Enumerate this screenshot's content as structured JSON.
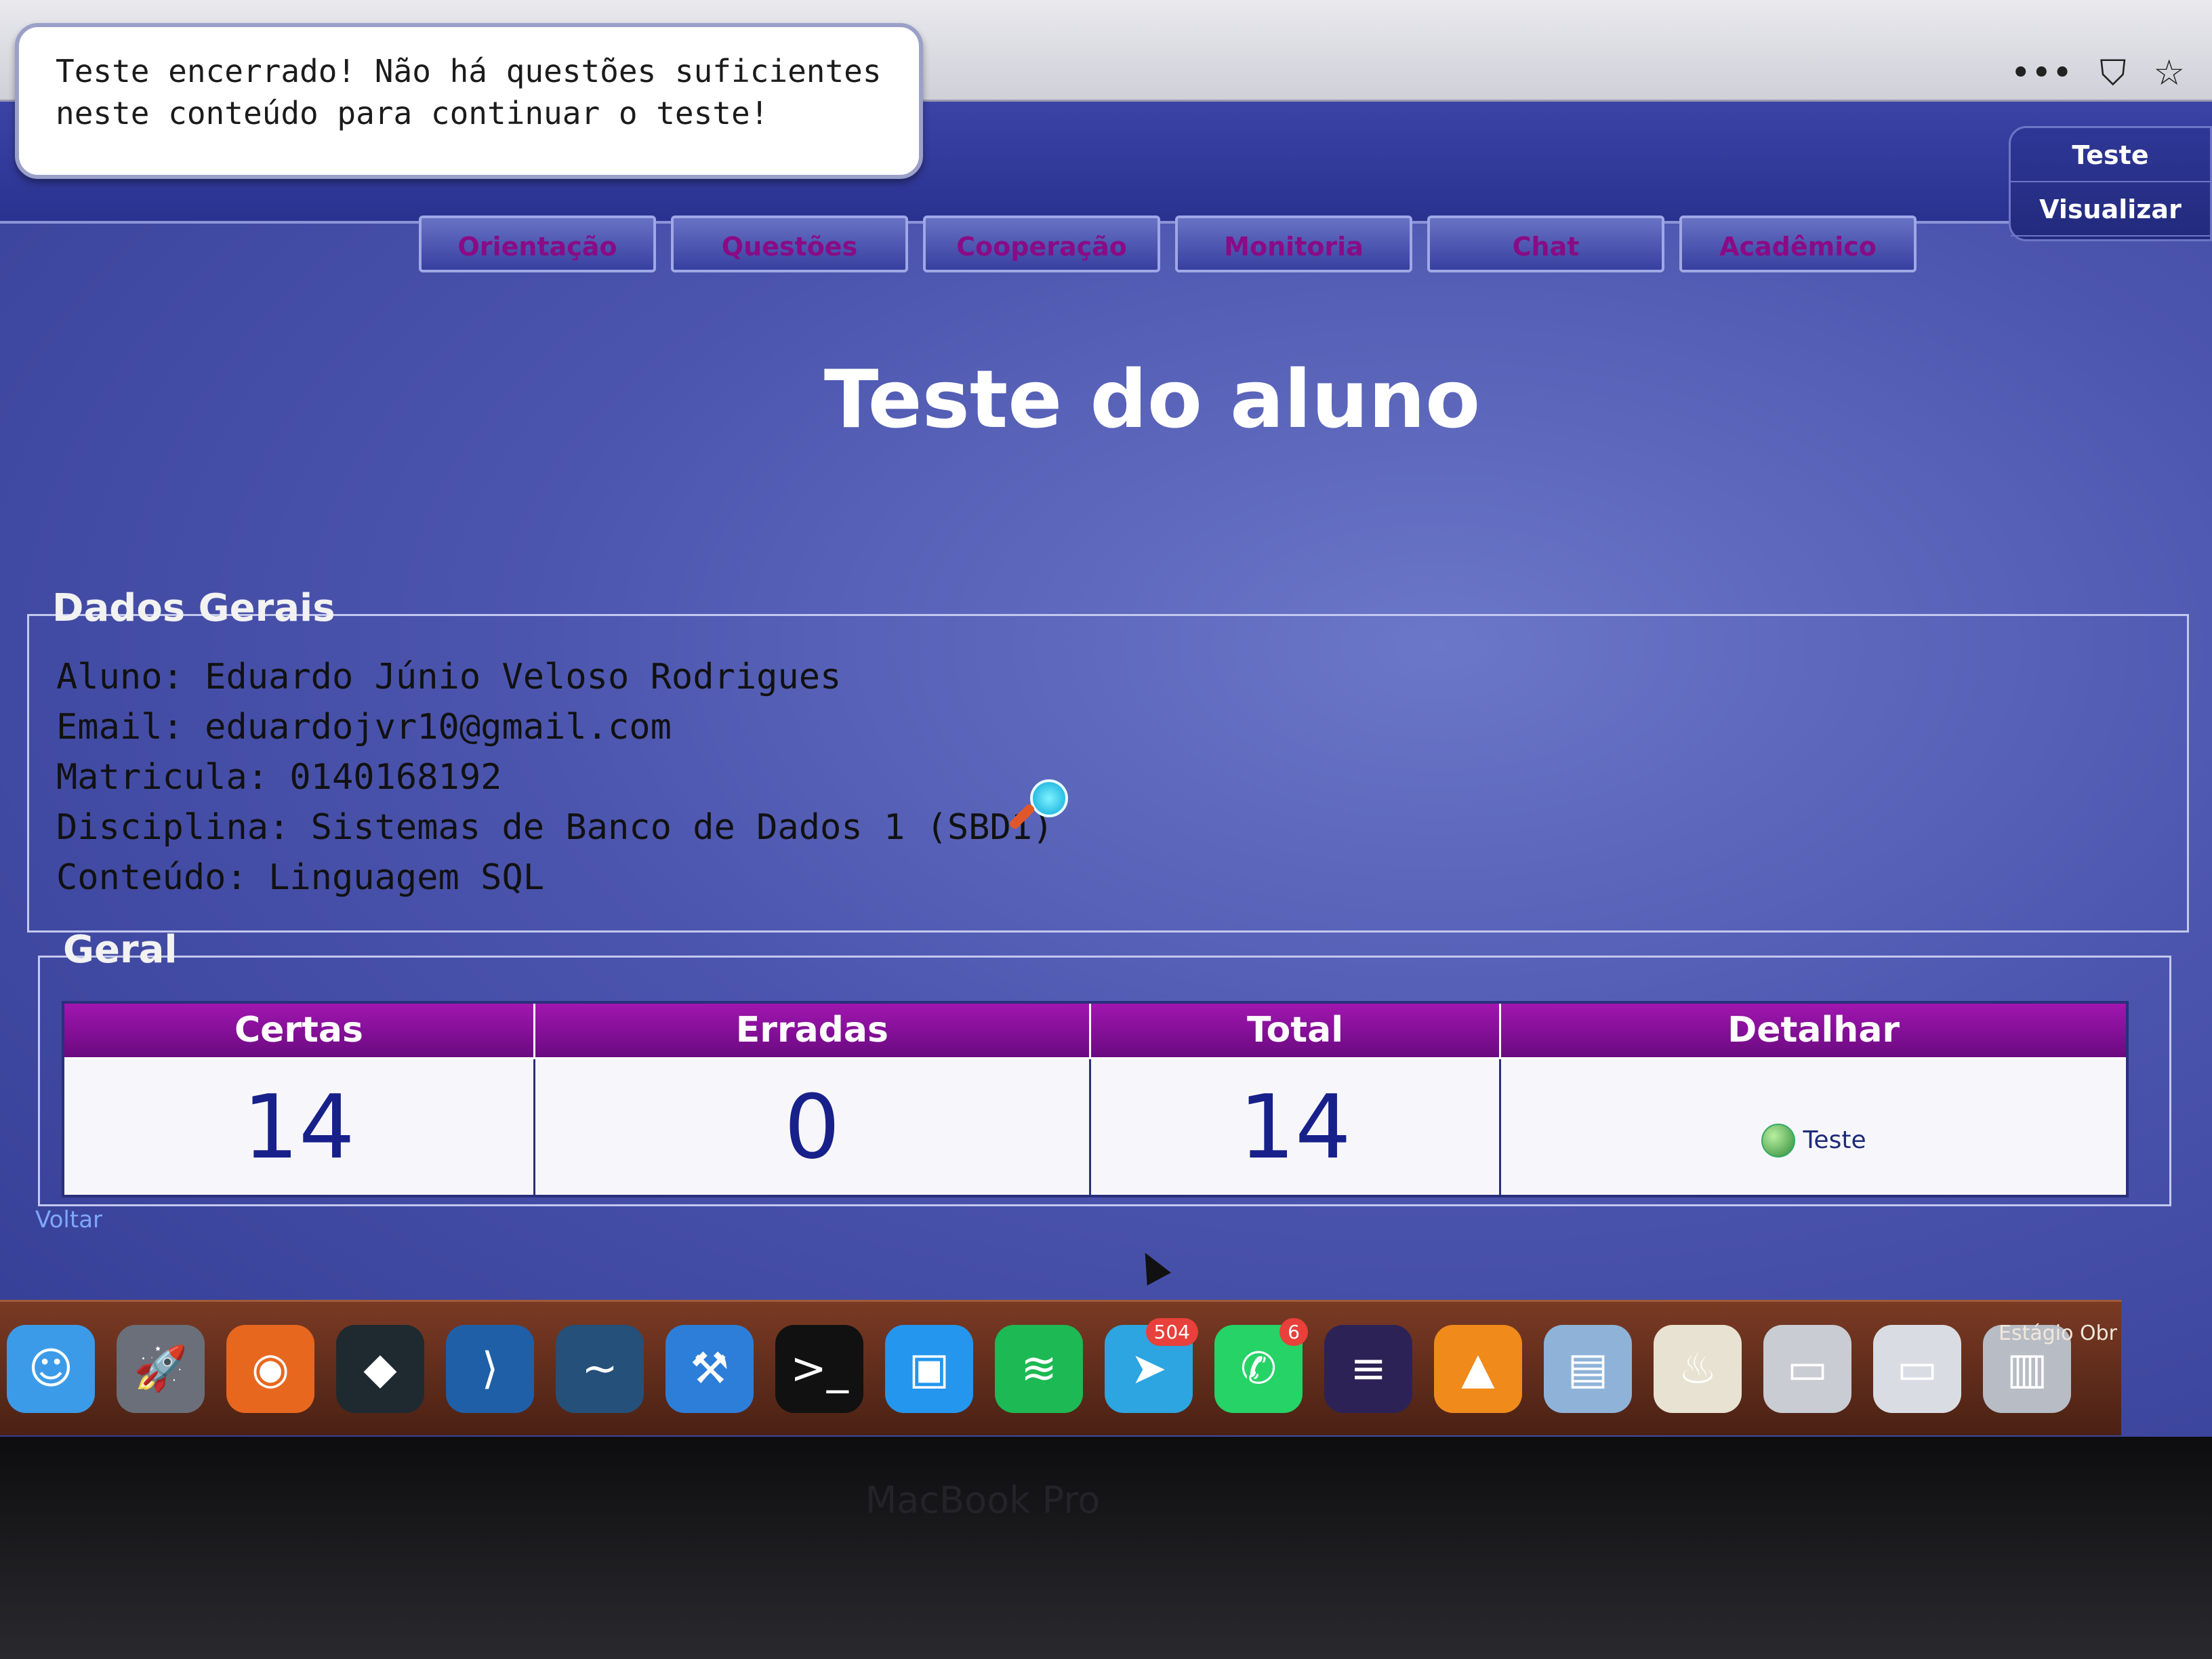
{
  "alert": {
    "message": "Teste encerrado! Não há questões suficientes neste conteúdo para continuar o teste!"
  },
  "browser": {
    "icons": [
      "more-icon",
      "pocket-icon",
      "star-icon"
    ]
  },
  "side_menu": {
    "items": [
      "Teste",
      "Visualizar"
    ]
  },
  "tabs": [
    "Orientação",
    "Questões",
    "Cooperação",
    "Monitoria",
    "Chat",
    "Acadêmico"
  ],
  "page": {
    "title": "Teste do aluno"
  },
  "dados_gerais": {
    "legend": "Dados Gerais",
    "aluno": "Aluno: Eduardo Júnio Veloso Rodrigues",
    "email": "Email: eduardojvr10@gmail.com",
    "matricula": "Matricula: 0140168192",
    "disciplina": "Disciplina: Sistemas de Banco de Dados 1 (SBD1)",
    "conteudo": "Conteúdo: Linguagem SQL"
  },
  "geral": {
    "legend": "Geral",
    "headers": [
      "Certas",
      "Erradas",
      "Total",
      "Detalhar"
    ],
    "certas": "14",
    "erradas": "0",
    "total": "14",
    "detalhar_link": "Teste"
  },
  "voltar": "Voltar",
  "dock": {
    "apps": [
      {
        "name": "finder-icon"
      },
      {
        "name": "launchpad-icon"
      },
      {
        "name": "firefox-icon"
      },
      {
        "name": "filmora-icon"
      },
      {
        "name": "vscode-icon"
      },
      {
        "name": "mysql-workbench-icon"
      },
      {
        "name": "xcode-icon"
      },
      {
        "name": "terminal-icon"
      },
      {
        "name": "docker-icon"
      },
      {
        "name": "spotify-icon"
      },
      {
        "name": "telegram-icon",
        "badge": "504"
      },
      {
        "name": "whatsapp-icon",
        "badge": "6"
      },
      {
        "name": "eclipse-icon"
      },
      {
        "name": "vlc-icon"
      },
      {
        "name": "preview-icon"
      },
      {
        "name": "java-icon"
      },
      {
        "name": "folder-icon"
      },
      {
        "name": "presentation-icon"
      },
      {
        "name": "trash-icon"
      }
    ],
    "folder_label": "Estágio Obr"
  },
  "bezel": {
    "label": "MacBook Pro"
  },
  "colors": {
    "header_tab_text": "#8a0b85",
    "table_header": "#8b12a0",
    "page_bg": "#4c55ae"
  }
}
